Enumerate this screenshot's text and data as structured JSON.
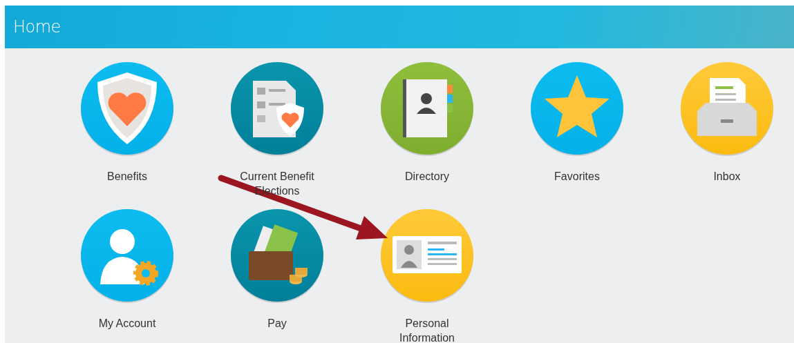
{
  "header": {
    "title": "Home"
  },
  "tiles": [
    {
      "kind": "benefits",
      "label": "Benefits"
    },
    {
      "kind": "elections",
      "label": "Current Benefit Elections"
    },
    {
      "kind": "directory",
      "label": "Directory"
    },
    {
      "kind": "favorites",
      "label": "Favorites"
    },
    {
      "kind": "inbox",
      "label": "Inbox"
    },
    {
      "kind": "account",
      "label": "My Account"
    },
    {
      "kind": "pay",
      "label": "Pay"
    },
    {
      "kind": "personal",
      "label": "Personal Information"
    }
  ]
}
